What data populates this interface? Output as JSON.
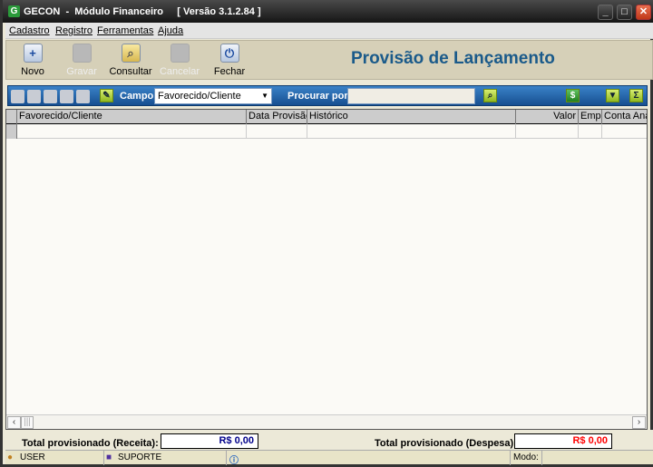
{
  "window": {
    "title": "GECON  -  Módulo Financeiro     [ Versão 3.1.2.84 ]",
    "logo": "G"
  },
  "menu": [
    "Cadastro",
    "Registro",
    "Ferramentas",
    "Ajuda"
  ],
  "toolbar": {
    "buttons": [
      {
        "label": "Novo",
        "icon": "plus-document-icon",
        "enabled": true
      },
      {
        "label": "Gravar",
        "icon": "save-icon",
        "enabled": false
      },
      {
        "label": "Consultar",
        "icon": "folder-search-icon",
        "enabled": true
      },
      {
        "label": "Cancelar",
        "icon": "cancel-icon",
        "enabled": false
      },
      {
        "label": "Fechar",
        "icon": "power-icon",
        "enabled": true
      }
    ],
    "title": "Provisão de Lançamento"
  },
  "search": {
    "campo_label": "Campo",
    "campo_value": "Favorecido/Cliente",
    "procurar_label": "Procurar por",
    "procurar_value": ""
  },
  "grid": {
    "columns": [
      "Favorecido/Cliente",
      "Data Provisão",
      "Histórico",
      "Valor",
      "Emp",
      "Conta Ana"
    ]
  },
  "totals": {
    "receita_label": "Total provisionado (Receita):",
    "receita_value": "R$ 0,00",
    "despesa_label": "Total provisionado (Despesa):",
    "despesa_value": "R$ 0,00",
    "receita_color": "#00008b",
    "despesa_color": "#ff0000"
  },
  "status": {
    "user": "USER",
    "machine": "SUPORTE",
    "modo_label": "Modo:",
    "modo_value": ""
  }
}
